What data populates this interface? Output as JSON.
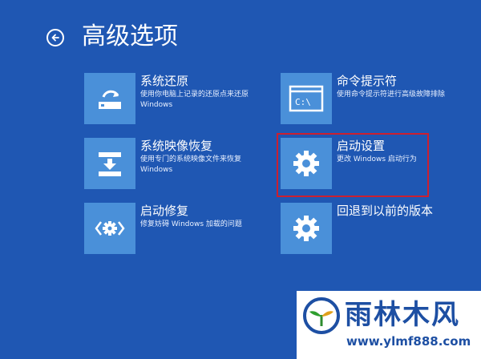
{
  "header": {
    "back_icon": "back-arrow-circle-icon",
    "title": "高级选项"
  },
  "options": [
    {
      "title": "系统还原",
      "description": "使用你电脑上记录的还原点来还原 Windows",
      "icon": "system-restore-icon"
    },
    {
      "title": "命令提示符",
      "description": "使用命令提示符进行高级故障排除",
      "icon": "command-prompt-icon",
      "icon_text": "C:\\"
    },
    {
      "title": "系统映像恢复",
      "description": "使用专门的系统映像文件来恢复 Windows",
      "icon": "system-image-recovery-icon"
    },
    {
      "title": "启动设置",
      "description": "更改 Windows 启动行为",
      "icon": "gear-icon",
      "highlighted": true
    },
    {
      "title": "启动修复",
      "description": "修复妨碍 Windows 加载的问题",
      "icon": "startup-repair-icon"
    },
    {
      "title": "回退到以前的版本",
      "description": "",
      "icon": "gear-icon"
    }
  ],
  "watermark": {
    "title": "雨林木风",
    "url": "www.ylmf888.com"
  },
  "colors": {
    "background": "#1f57b3",
    "tile": "#4a90d9",
    "highlight_border": "#cc1f2f",
    "watermark_text": "#1d4fa3"
  }
}
